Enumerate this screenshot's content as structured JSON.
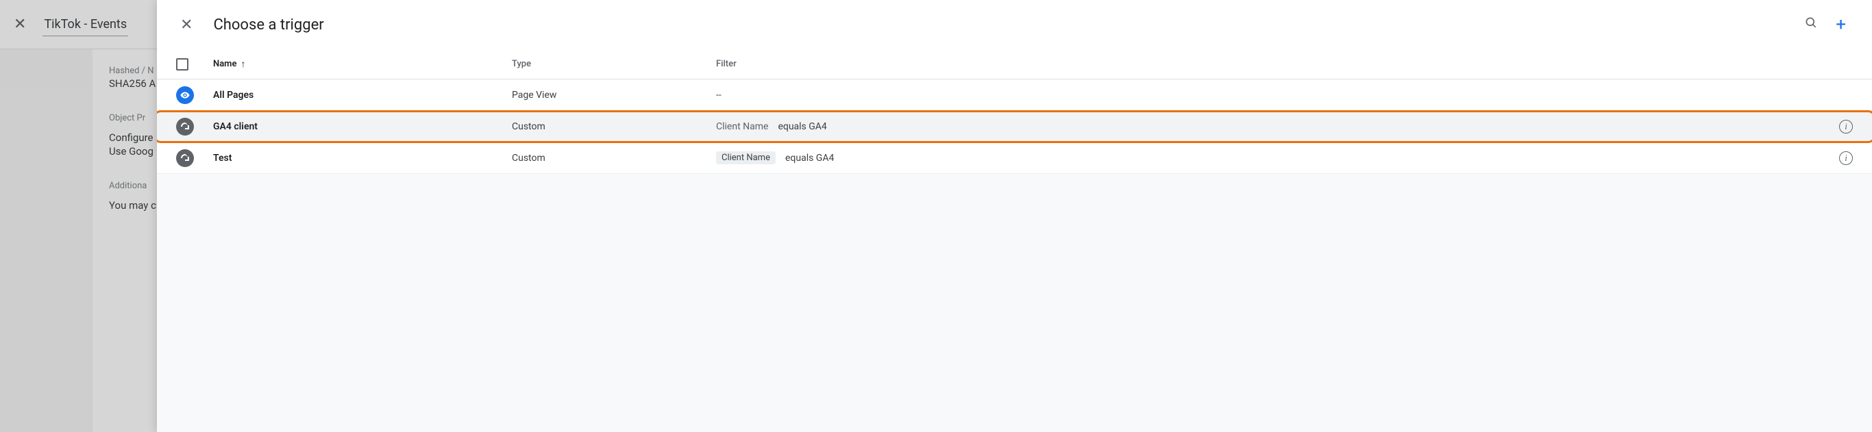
{
  "background": {
    "title": "TikTok - Events",
    "labels": {
      "hashed": "Hashed / N",
      "sha": "SHA256 A",
      "objProps": "Object Pr",
      "configure": "Configure",
      "useGoog": "Use Goog",
      "additional": "Additiona",
      "youMay": "You may c"
    }
  },
  "drawer": {
    "title": "Choose a trigger",
    "columns": {
      "name": "Name",
      "type": "Type",
      "filter": "Filter"
    }
  },
  "rows": [
    {
      "icon": "eye",
      "iconColor": "blue",
      "name": "All Pages",
      "type": "Page View",
      "filterKey": "",
      "filterOp": "--",
      "filterVal": "",
      "chip": false,
      "info": false,
      "highlight": false,
      "ring": false
    },
    {
      "icon": "swirl",
      "iconColor": "grey",
      "name": "GA4 client",
      "type": "Custom",
      "filterKey": "Client Name",
      "filterOp": "equals GA4",
      "filterVal": "",
      "chip": false,
      "info": true,
      "highlight": true,
      "ring": true
    },
    {
      "icon": "swirl",
      "iconColor": "grey",
      "name": "Test",
      "type": "Custom",
      "filterKey": "Client Name",
      "filterOp": "equals GA4",
      "filterVal": "",
      "chip": true,
      "info": true,
      "highlight": false,
      "ring": false
    }
  ]
}
